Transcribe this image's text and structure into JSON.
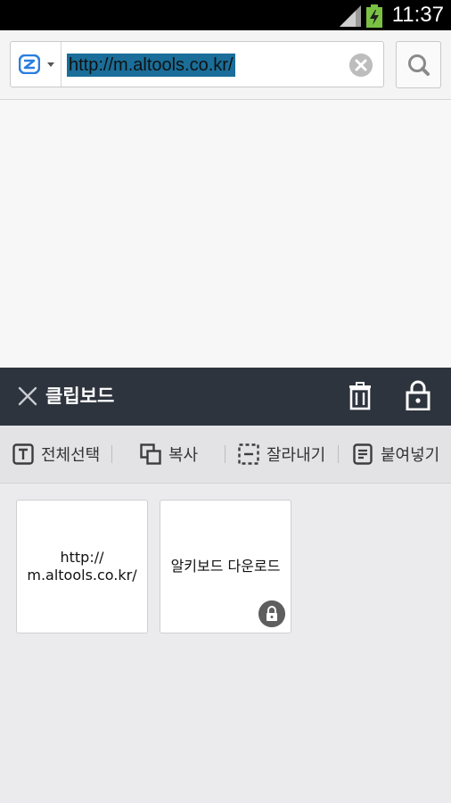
{
  "status": {
    "time": "11:37",
    "signal_icon": "signal-icon",
    "battery_icon": "battery-charging-icon"
  },
  "browser": {
    "engine_icon": "search-engine-icon",
    "url": "http://m.altools.co.kr/",
    "clear_icon": "clear-icon",
    "search_icon": "search-icon"
  },
  "clipboard": {
    "title": "클립보드",
    "close_icon": "close-icon",
    "trash_icon": "trash-icon",
    "lock_icon": "lock-icon",
    "toolbar": {
      "select_all": "전체선택",
      "copy": "복사",
      "cut": "잘라내기",
      "paste": "붙여넣기"
    },
    "items": [
      {
        "line1": "http://",
        "line2": "m.altools.co.kr/",
        "locked": false
      },
      {
        "text": "알키보드 다운로드",
        "locked": true
      }
    ]
  },
  "colors": {
    "header_bg": "#2d343d",
    "url_highlight": "#1a6e99",
    "engine_blue": "#2a7de1",
    "battery_green": "#7ac143"
  }
}
